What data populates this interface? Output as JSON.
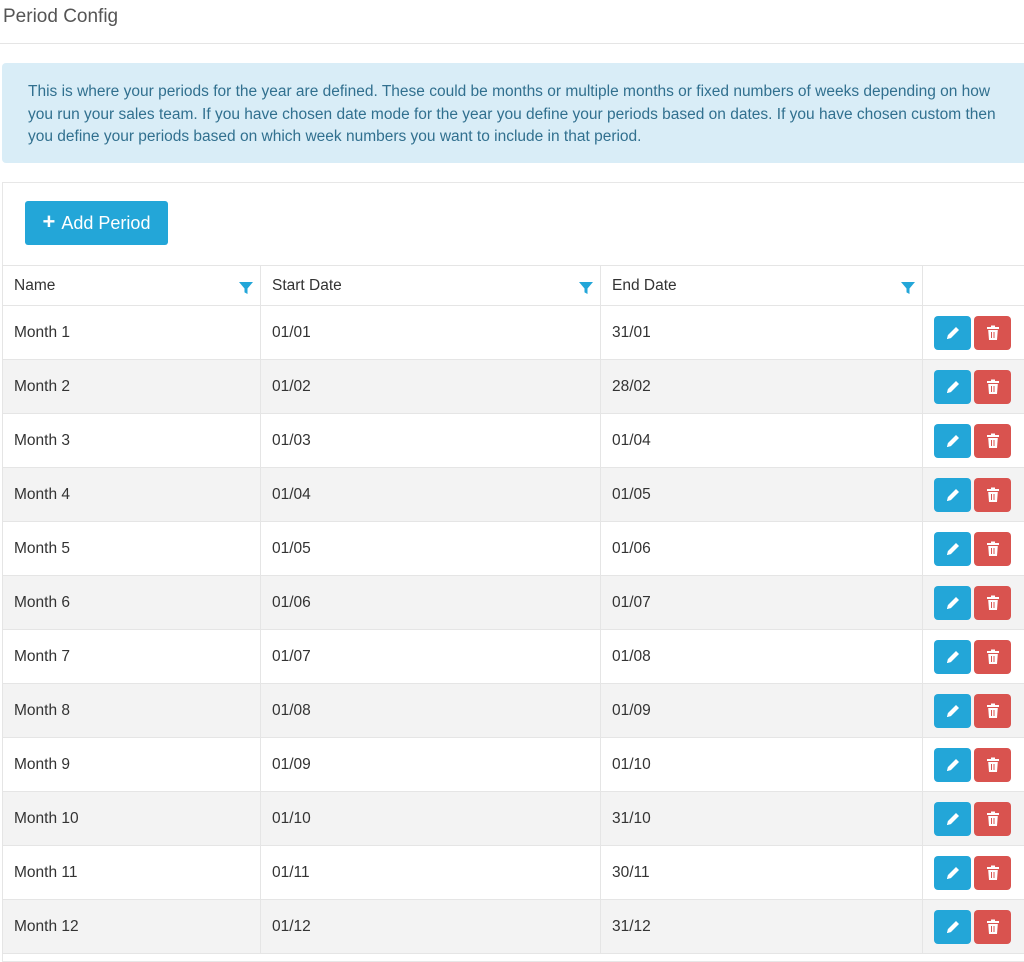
{
  "header": {
    "title": "Period Config"
  },
  "info": {
    "text": "This is where your periods for the year are defined. These could be months or multiple months or fixed numbers of weeks depending on how you run your sales team. If you have chosen date mode for the year you define your periods based on dates. If you have chosen custom then you define your periods based on which week numbers you want to include in that period."
  },
  "toolbar": {
    "add_label": "Add Period",
    "add_icon": "plus-icon"
  },
  "table": {
    "columns": [
      "Name",
      "Start Date",
      "End Date",
      ""
    ],
    "filter_icon": "filter-icon",
    "rows": [
      {
        "name": "Month 1",
        "start": "01/01",
        "end": "31/01"
      },
      {
        "name": "Month 2",
        "start": "01/02",
        "end": "28/02"
      },
      {
        "name": "Month 3",
        "start": "01/03",
        "end": "01/04"
      },
      {
        "name": "Month 4",
        "start": "01/04",
        "end": "01/05"
      },
      {
        "name": "Month 5",
        "start": "01/05",
        "end": "01/06"
      },
      {
        "name": "Month 6",
        "start": "01/06",
        "end": "01/07"
      },
      {
        "name": "Month 7",
        "start": "01/07",
        "end": "01/08"
      },
      {
        "name": "Month 8",
        "start": "01/08",
        "end": "01/09"
      },
      {
        "name": "Month 9",
        "start": "01/09",
        "end": "01/10"
      },
      {
        "name": "Month 10",
        "start": "01/10",
        "end": "31/10"
      },
      {
        "name": "Month 11",
        "start": "01/11",
        "end": "30/11"
      },
      {
        "name": "Month 12",
        "start": "01/12",
        "end": "31/12"
      }
    ],
    "row_actions": [
      "pencil-icon",
      "trash-icon"
    ]
  },
  "colors": {
    "accent": "#23a6d8",
    "danger": "#d9534f",
    "info_bg": "#d9edf7",
    "info_text": "#31708f"
  }
}
